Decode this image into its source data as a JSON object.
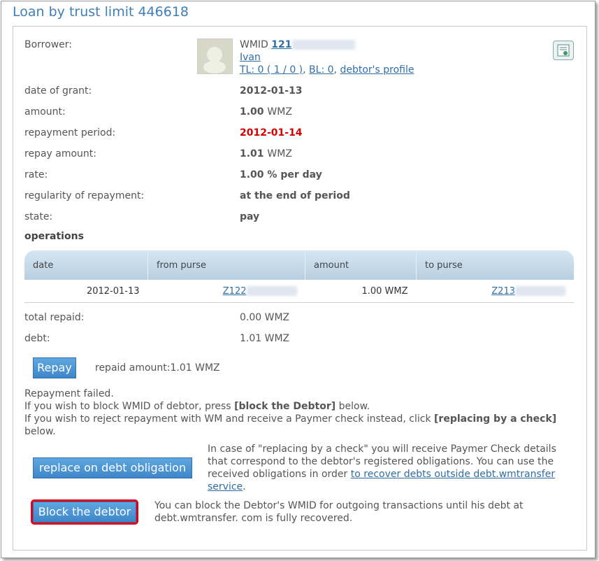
{
  "title": "Loan by trust limit 446618",
  "borrower": {
    "label": "Borrower:",
    "wmid_prefix": "WMID",
    "wmid": "121",
    "name": "Ivan",
    "tl_label": "TL: 0 ( 1 / 0 )",
    "bl_label": "BL: 0",
    "profile_link": "debtor's profile"
  },
  "fields": {
    "date_of_grant_label": "date of grant:",
    "date_of_grant": "2012-01-13",
    "amount_label": "amount:",
    "amount_value": "1.00",
    "amount_unit": "WMZ",
    "repayment_period_label": "repayment period:",
    "repayment_period": "2012-01-14",
    "repay_amount_label": "repay amount:",
    "repay_amount_value": "1.01",
    "repay_amount_unit": "WMZ",
    "rate_label": "rate:",
    "rate": "1.00 % per day",
    "regularity_label": "regularity of repayment:",
    "regularity": "at the end of period",
    "state_label": "state:",
    "state": "pay"
  },
  "operations": {
    "heading": "operations",
    "columns": [
      "date",
      "from purse",
      "amount",
      "to purse"
    ],
    "rows": [
      {
        "date": "2012-01-13",
        "from": "Z122",
        "amount": "1.00 WMZ",
        "to": "Z213"
      }
    ]
  },
  "totals": {
    "total_repaid_label": "total repaid:",
    "total_repaid": "0.00 WMZ",
    "debt_label": "debt:",
    "debt": "1.01 WMZ"
  },
  "repay": {
    "button": "Repay",
    "repaid_amount": "repaid amount:1.01 WMZ"
  },
  "message": {
    "line1": "Repayment failed.",
    "line2_pre": "If you wish to block WMID of debtor, press",
    "line2_bold": "[block the Debtor]",
    "line2_post": "below.",
    "line3_pre": "If you wish to reject repayment with WM and receive a Paymer check instead, click",
    "line3_bold": "[replacing by a check]",
    "line3_post": "below."
  },
  "replace": {
    "button": "replace on debt obligation",
    "text": "In case of \"replacing by a check\" you will receive Paymer Check details that correspond to the debtor's registered obligations. You can use the received obligations in order",
    "link": "to recover debts outside debt.wmtransfer service",
    "text_end": "."
  },
  "block": {
    "button": "Block the debtor",
    "text": "You can block the Debtor's WMID for outgoing transactions until his debt at debt.wmtransfer. com is fully recovered."
  }
}
